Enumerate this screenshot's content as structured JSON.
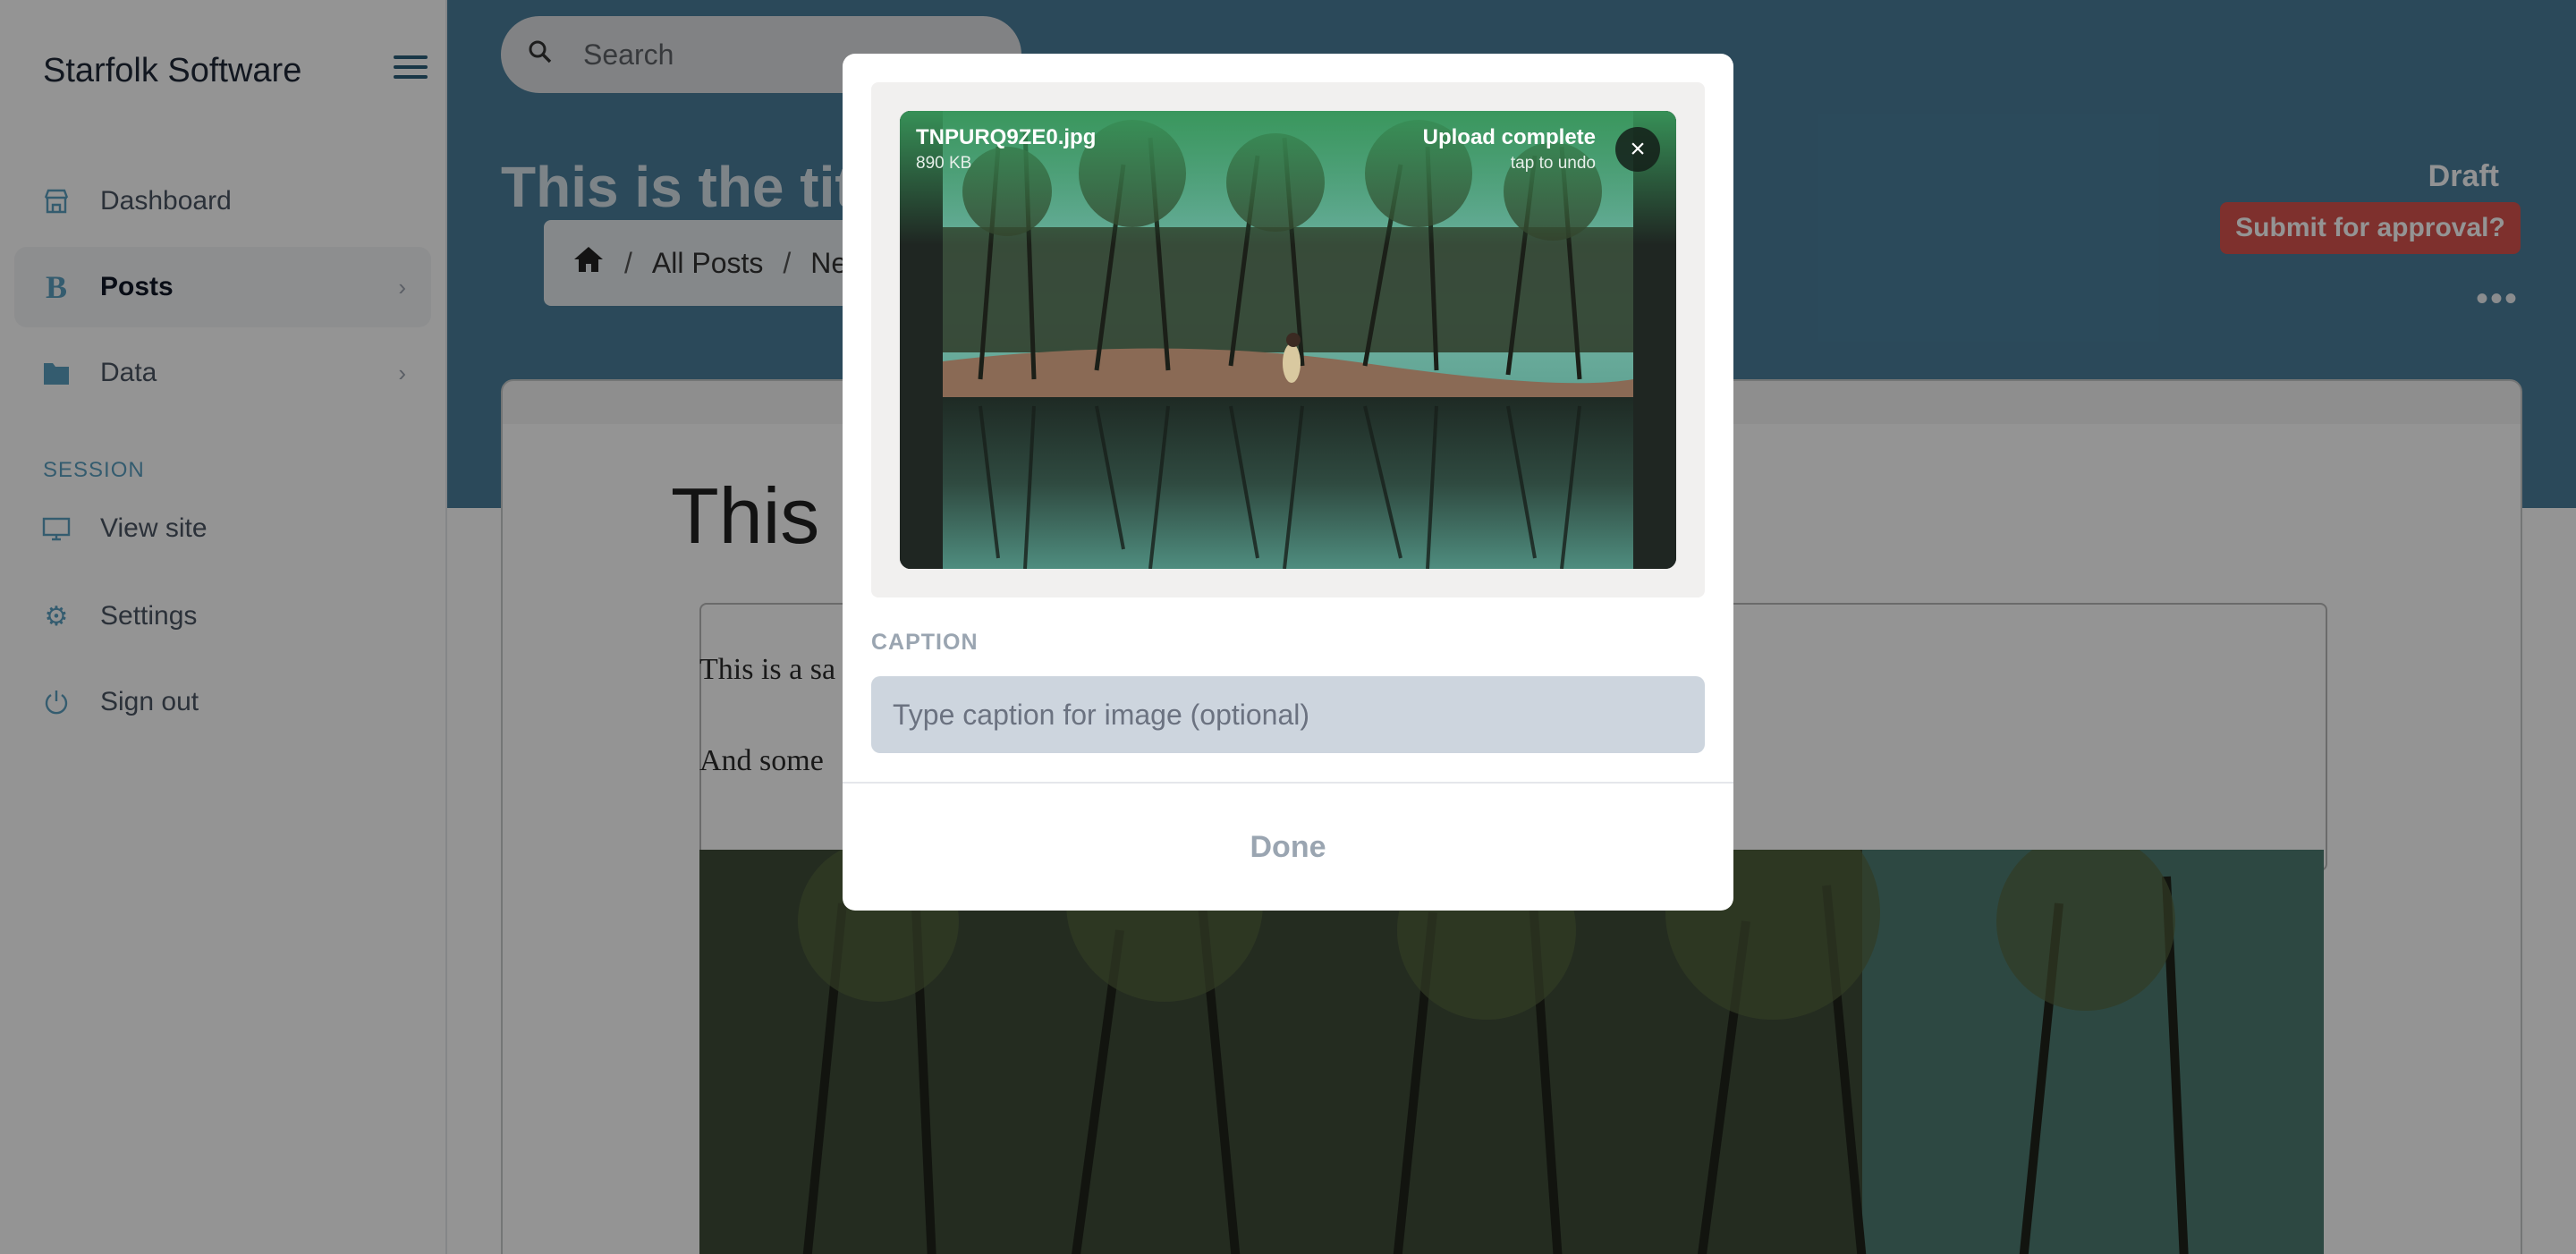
{
  "sidebar": {
    "brand": "Starfolk Software",
    "items": [
      {
        "label": "Dashboard",
        "icon": "store-icon"
      },
      {
        "label": "Posts",
        "icon": "bold-b-icon"
      },
      {
        "label": "Data",
        "icon": "folder-icon"
      }
    ],
    "section_label": "SESSION",
    "session_items": [
      {
        "label": "View site",
        "icon": "monitor-icon"
      },
      {
        "label": "Settings",
        "icon": "gear-icon"
      },
      {
        "label": "Sign out",
        "icon": "power-icon"
      }
    ]
  },
  "header": {
    "search_placeholder": "Search",
    "page_title": "This is the title",
    "breadcrumb": [
      "All Posts",
      "Ne"
    ],
    "status": "Draft",
    "submit_label": "Submit for approval?",
    "more_label": "•••"
  },
  "editor": {
    "post_title": "This i",
    "paragraph_1": "This is a sa",
    "paragraph_2": "And some"
  },
  "modal": {
    "file_name": "TNPURQ9ZE0.jpg",
    "file_size": "890 KB",
    "upload_status": "Upload complete",
    "undo_hint": "tap to undo",
    "remove_label": "×",
    "caption_label": "CAPTION",
    "caption_placeholder": "Type caption for image (optional)",
    "caption_value": "",
    "done_label": "Done"
  },
  "colors": {
    "accent": "#5b9fc0",
    "header_band": "#4a7f9c",
    "submit": "#d9534f",
    "upload_green": "#38965a"
  }
}
